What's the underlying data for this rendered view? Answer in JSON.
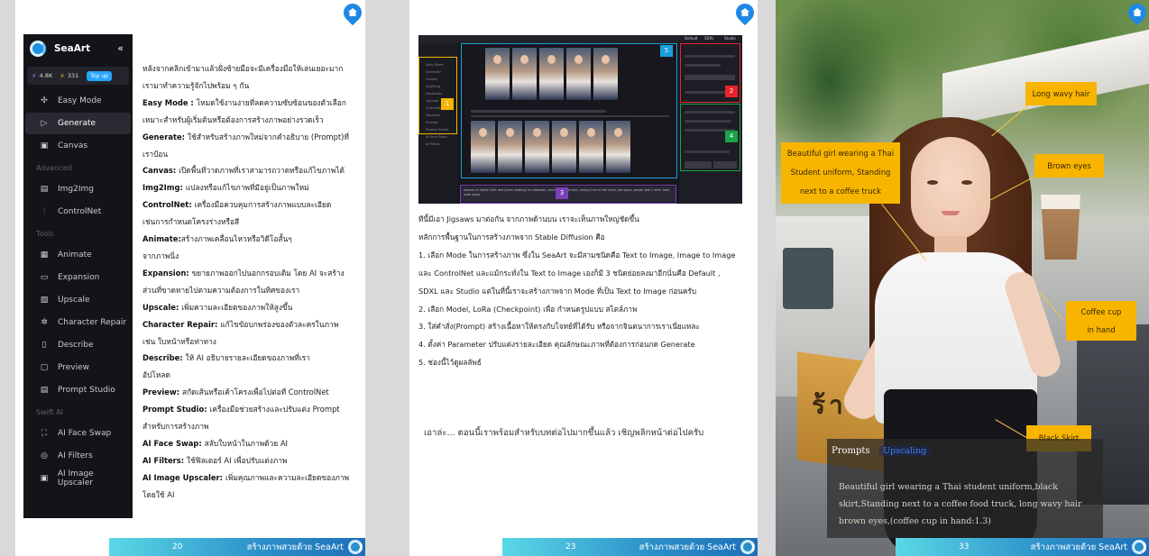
{
  "page1": {
    "footer_num": "20",
    "footer_title": "สร้างภาพสวยด้วย SeaArt",
    "sidebar": {
      "brand": "SeaArt",
      "collapse_icon": "«",
      "credits": "4.8K",
      "stamina": "331",
      "topup": "Top up",
      "items": [
        {
          "label": "Easy Mode",
          "icon": "✣"
        },
        {
          "label": "Generate",
          "icon": "▷"
        },
        {
          "label": "Canvas",
          "icon": "▣"
        }
      ],
      "section_advanced": "Advanced",
      "advanced_items": [
        {
          "label": "Img2Img",
          "icon": "▤"
        },
        {
          "label": "ControlNet",
          "icon": "⫶"
        }
      ],
      "section_tools": "Tools",
      "tool_items": [
        {
          "label": "Animate",
          "icon": "▦"
        },
        {
          "label": "Expansion",
          "icon": "▭"
        },
        {
          "label": "Upscale",
          "icon": "▧"
        },
        {
          "label": "Character Repair",
          "icon": "✲"
        },
        {
          "label": "Describe",
          "icon": "▯"
        },
        {
          "label": "Preview",
          "icon": "▢"
        },
        {
          "label": "Prompt Studio",
          "icon": "▤"
        }
      ],
      "section_swift": "Swift AI",
      "swift_items": [
        {
          "label": "AI Face Swap",
          "icon": "⛶"
        },
        {
          "label": "AI Filters",
          "icon": "◎"
        },
        {
          "label": "AI Image Upscaler",
          "icon": "▣"
        }
      ]
    },
    "lines": [
      {
        "b": "",
        "t": "หลังจากคลิกเข้ามาแล้วฝั่งซ้ายมือจะมีเครื่องมือให้เล่นเยอะมาก"
      },
      {
        "b": "",
        "t": "เรามาทำความรู้จักไปพร้อม ๆ กัน"
      },
      {
        "b": "Easy Mode : ",
        "t": "โหมดใช้งานง่ายที่ลดความซับซ้อนของตัวเลือก"
      },
      {
        "b": "",
        "t": "เหมาะสำหรับผู้เริ่มต้นหรือต้องการสร้างภาพอย่างรวดเร็ว"
      },
      {
        "b": "Generate: ",
        "t": "ใช้สำหรับสร้างภาพใหม่จากคำอธิบาย (Prompt)ที่"
      },
      {
        "b": "",
        "t": "เราป้อน"
      },
      {
        "b": "Canvas: ",
        "t": "เปิดพื้นที่วาดภาพที่เราสามารถวาดหรือแก้ไขภาพได้"
      },
      {
        "b": "Img2Img: ",
        "t": "แปลงหรือแก้ไขภาพที่มีอยู่เป็นภาพใหม่"
      },
      {
        "b": "ControlNet: ",
        "t": "เครื่องมือควบคุมการสร้างภาพแบบละเอียด"
      },
      {
        "b": "",
        "t": "เช่นการกำหนดโครงร่างหรือสี"
      },
      {
        "b": "Animate:",
        "t": "สร้างภาพเคลื่อนไหวหรือวิดีโอสั้นๆ"
      },
      {
        "b": "",
        "t": "จากภาพนิ่ง"
      },
      {
        "b": "Expansion: ",
        "t": "ขยายภาพออกไปนอกกรอบเดิม โดย AI จะสร้าง"
      },
      {
        "b": "",
        "t": "ส่วนที่ขาดหายไปตามความต้องการในทิศของเรา"
      },
      {
        "b": "Upscale: ",
        "t": "เพิ่มความละเอียดของภาพให้สูงขึ้น"
      },
      {
        "b": "Character Repair: ",
        "t": "แก้ไขข้อบกพร่องของตัวละครในภาพ"
      },
      {
        "b": "",
        "t": "เช่น ใบหน้าหรือท่าทาง"
      },
      {
        "b": "Describe: ",
        "t": "ให้ AI อธิบายรายละเอียดของภาพที่เรา"
      },
      {
        "b": "",
        "t": "อัปโหลด"
      },
      {
        "b": "Preview: ",
        "t": "สกัดเส้นหรือเค้าโครงเพื่อไปต่อที่ ControlNet"
      },
      {
        "b": "Prompt Studio: ",
        "t": "เครื่องมือช่วยสร้างและปรับแต่ง Prompt"
      },
      {
        "b": "",
        "t": "สำหรับการสร้างภาพ"
      },
      {
        "b": "AI Face Swap: ",
        "t": "สลับใบหน้าในภาพด้วย AI"
      },
      {
        "b": "AI Filters: ",
        "t": "ใช้ฟิลเตอร์ AI เพื่อปรับแต่งภาพ"
      },
      {
        "b": "AI Image Upscaler: ",
        "t": "เพิ่มคุณภาพและความละเอียดของภาพ"
      },
      {
        "b": "",
        "t": "โดยใช้ AI"
      }
    ]
  },
  "page2": {
    "footer_num": "23",
    "footer_title": "สร้างภาพสวยด้วย SeaArt",
    "screenshot": {
      "tabs": [
        "Default",
        "SDXL",
        "Studio"
      ],
      "prompt_sample": "woman in white shirt and jeans walking on sidewalk, leaning on the wall, messy hair in the wind, low pose, power wall t shirt, feet wide apart",
      "badges": [
        "1",
        "2",
        "3",
        "4",
        "5"
      ],
      "badge_colors": [
        "#f7b500",
        "#e8242c",
        "#7b3fb8",
        "#19a34a",
        "#1aa0d8"
      ]
    },
    "lines": [
      "ทีนี้มีเอา Jigsaws มาต่อกัน จากภาพด้านบน เราจะเห็นภาพใหญ่ชัดขึ้น",
      "หลักการพื้นฐานในการสร้างภาพจาก Stable Diffusion คือ",
      "1. เลือก Mode ในการสร้างภาพ ซึ่งใน SeaArt จะมีสามชนิดคือ Text to Image, Image to Image",
      "และ ControlNet และแม้กระทั่งใน Text to Image เองก็มี 3 ชนิดย่อยลงมาอีกนั่นคือ Default ,",
      "SDXL และ Studio แต่ในที่นี้เราจะสร้างภาพจาก Mode ที่เป็น Text to Image ก่อนครับ",
      "2. เลือก Model, LoRa (Checkpoint) เพื่อ กำหนดรูปแบบ สไตล์ภาพ",
      "3. ใส่คำสั่ง(Prompt) สร้างเนื้อหาให้ตรงกับโจทย์ที่ได้รับ หรือจากจินตนาการเราเนี่ยแหละ",
      "4. ตั้งค่า Parameter ปรับแต่งรายละเอียด คุณลักษณะภาพที่ต้องการก่อนกด Generate",
      "5. ช่องนี้ไว้ดูผลลัพธ์"
    ],
    "closing": "เอาล่ะ... ตอนนี้เราพร้อมสำหรับบทต่อไปมากขึ้นแล้ว เชิญพลิกหน้าต่อไปครับ"
  },
  "page3": {
    "footer_num": "33",
    "footer_title": "สร้างภาพสวยด้วย SeaArt",
    "callouts": {
      "hair": "Long wavy hair",
      "eyes": "Brown eyes",
      "uniform": [
        "Beautiful girl wearing a Thai",
        "Student uniform, Standing",
        "next to a coffee truck"
      ],
      "cup": [
        "Coffee cup",
        "in hand"
      ],
      "skirt": "Black Skirt"
    },
    "sign_text": "ร้าน C",
    "prompt_card": {
      "title": "Prompts",
      "tab": "Upscaling",
      "body": "Beautiful girl wearing a Thai student uniform,black skirt,Standing next to a coffee food truck, long wavy hair brown eyes,(coffee cup in hand:1.3)"
    }
  },
  "colors": {
    "callout": "#f7b500",
    "footer_gradient_start": "#5ad8e6",
    "footer_gradient_end": "#1f6fb8",
    "sidebar_bg": "#141418"
  }
}
